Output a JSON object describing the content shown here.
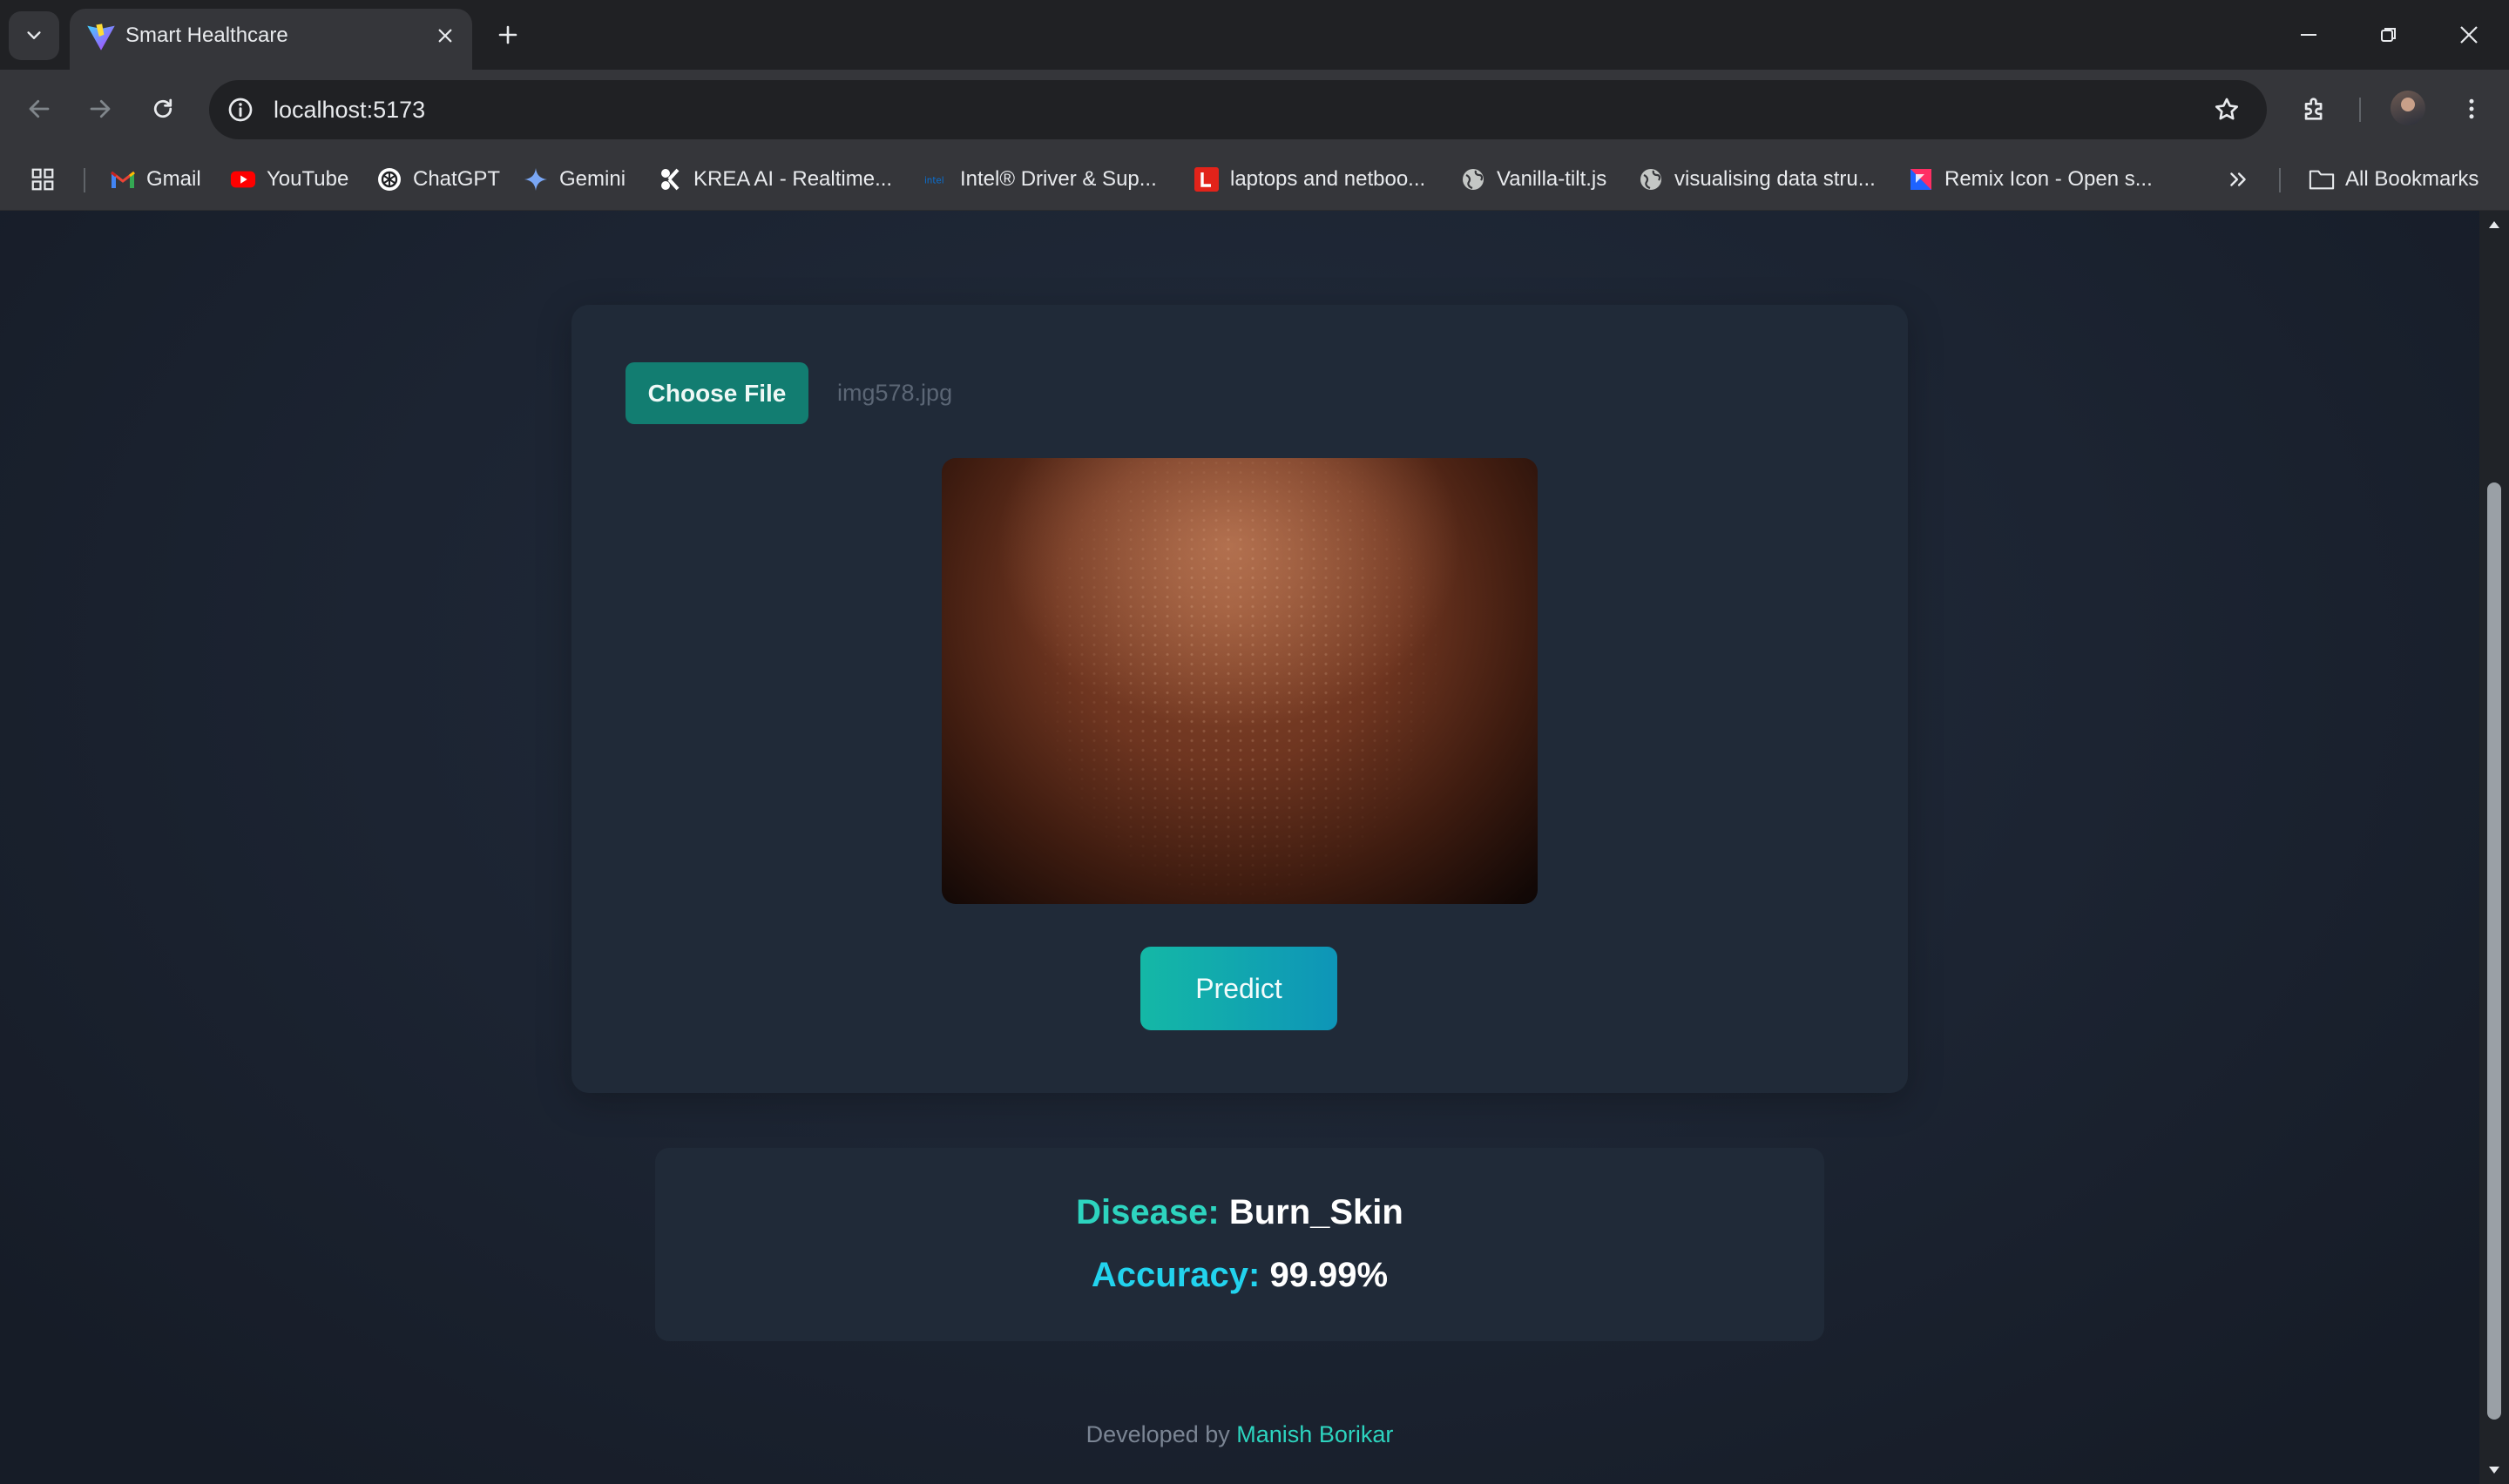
{
  "browser": {
    "tab": {
      "title": "Smart Healthcare"
    },
    "address": {
      "url": "localhost:5173"
    },
    "bookmarks": [
      {
        "label": "Gmail",
        "icon": "gmail-icon"
      },
      {
        "label": "YouTube",
        "icon": "youtube-icon"
      },
      {
        "label": "ChatGPT",
        "icon": "chatgpt-icon"
      },
      {
        "label": "Gemini",
        "icon": "gemini-icon"
      },
      {
        "label": "KREA AI - Realtime...",
        "icon": "krea-icon"
      },
      {
        "label": "Intel® Driver & Sup...",
        "icon": "intel-icon"
      },
      {
        "label": "laptops and netboo...",
        "icon": "lenovo-icon"
      },
      {
        "label": "Vanilla-tilt.js",
        "icon": "globe-icon"
      },
      {
        "label": "visualising data stru...",
        "icon": "globe-icon"
      },
      {
        "label": "Remix Icon - Open s...",
        "icon": "remix-icon"
      }
    ],
    "all_bookmarks": "All Bookmarks"
  },
  "upload": {
    "choose_label": "Choose File",
    "file_name": "img578.jpg",
    "predict_label": "Predict"
  },
  "result": {
    "disease_label": "Disease:",
    "disease_value": "Burn_Skin",
    "accuracy_label": "Accuracy:",
    "accuracy_value": "99.99%"
  },
  "footer": {
    "prefix": "Developed by",
    "author": "Manish Borikar"
  },
  "colors": {
    "accent_teal": "#2dd4bf",
    "accent_cyan": "#22d3ee",
    "card_bg": "#202a38",
    "page_bg": "#1b2331"
  }
}
